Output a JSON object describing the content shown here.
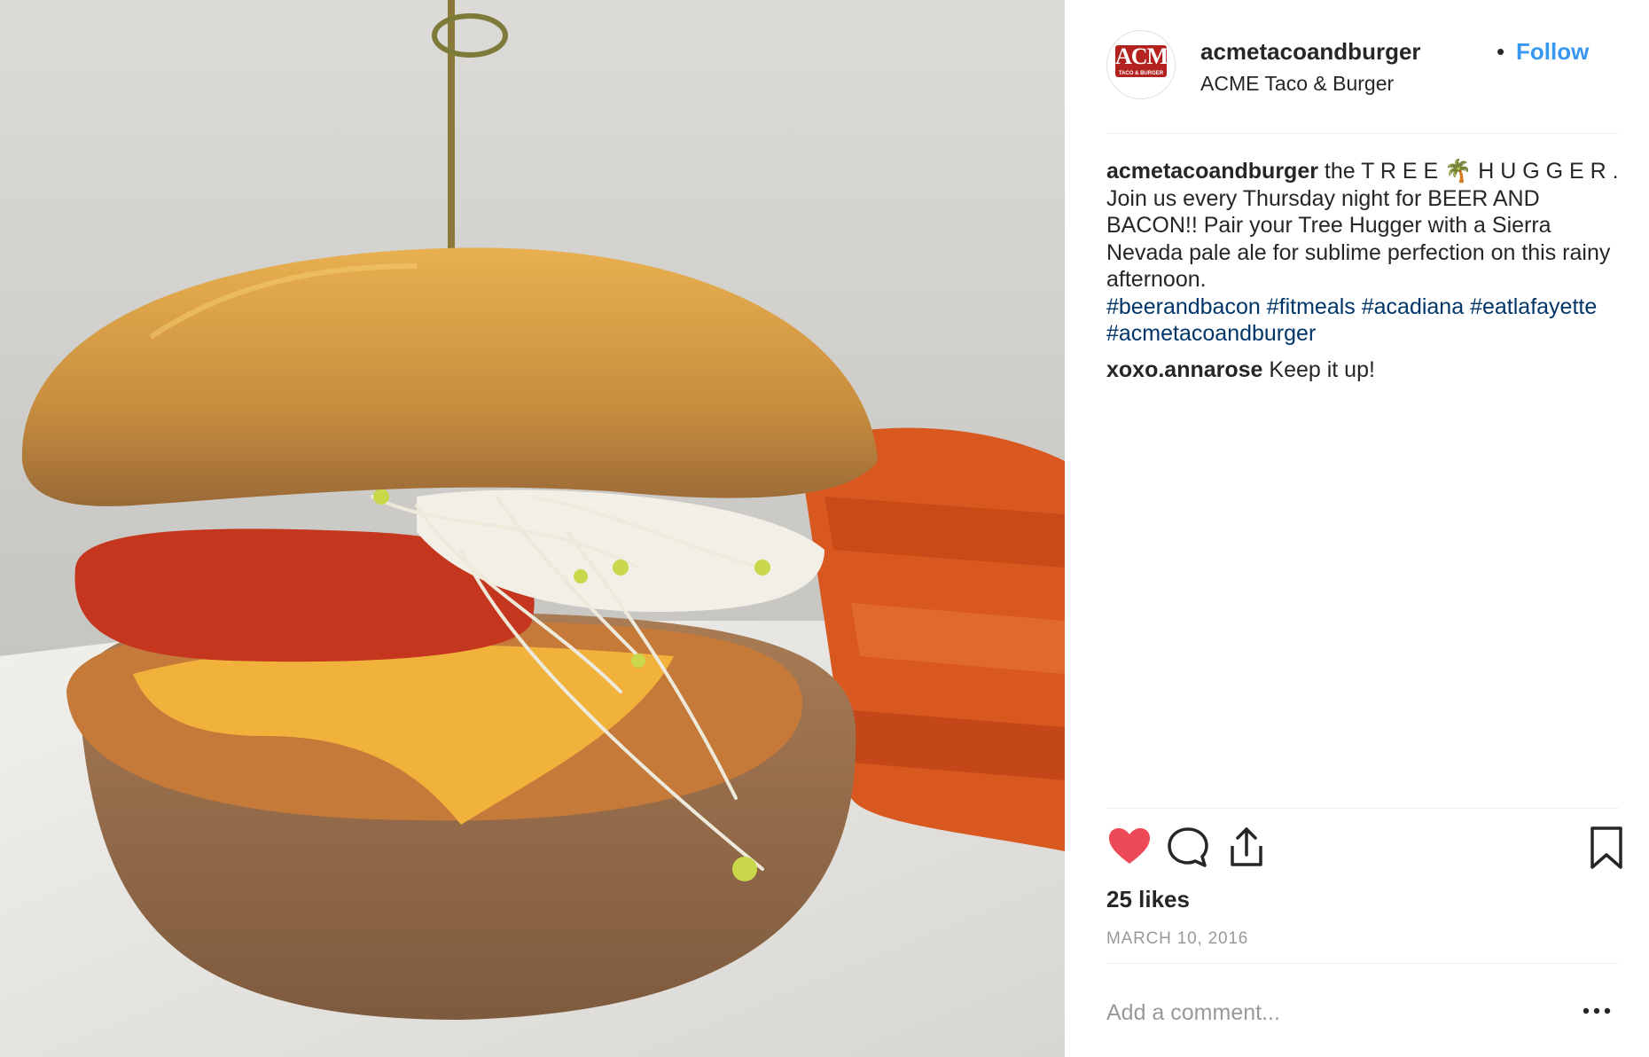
{
  "post": {
    "username": "acmetacoandburger",
    "separator": "•",
    "follow_label": "Follow",
    "location": "ACME Taco & Burger",
    "avatar_logo_text": "ACME",
    "avatar_logo_subtext": "TACO & BURGER"
  },
  "caption": {
    "username": "acmetacoandburger",
    "title": "the T R E E 🌴 H U G G E R .",
    "body": "Join us every Thursday night for BEER AND BACON!! Pair your Tree Hugger with a Sierra Nevada pale ale for sublime perfection on this rainy afternoon.",
    "hashtags": [
      "#beerandbacon",
      "#fitmeals",
      "#acadiana",
      "#eatlafayette",
      "#acmetacoandburger"
    ]
  },
  "comments": [
    {
      "username": "xoxo.annarose",
      "text": "Keep it up!"
    }
  ],
  "actions": {
    "like_icon": "heart-icon",
    "comment_icon": "comment-bubble-icon",
    "share_icon": "share-icon",
    "save_icon": "bookmark-icon",
    "liked": true
  },
  "likes_text": "25 likes",
  "date": "MARCH 10, 2016",
  "add_comment_placeholder": "Add a comment...",
  "more_label": "...",
  "colors": {
    "follow": "#3897f0",
    "hashtag": "#003569",
    "like": "#ed4956",
    "date": "#999999"
  }
}
